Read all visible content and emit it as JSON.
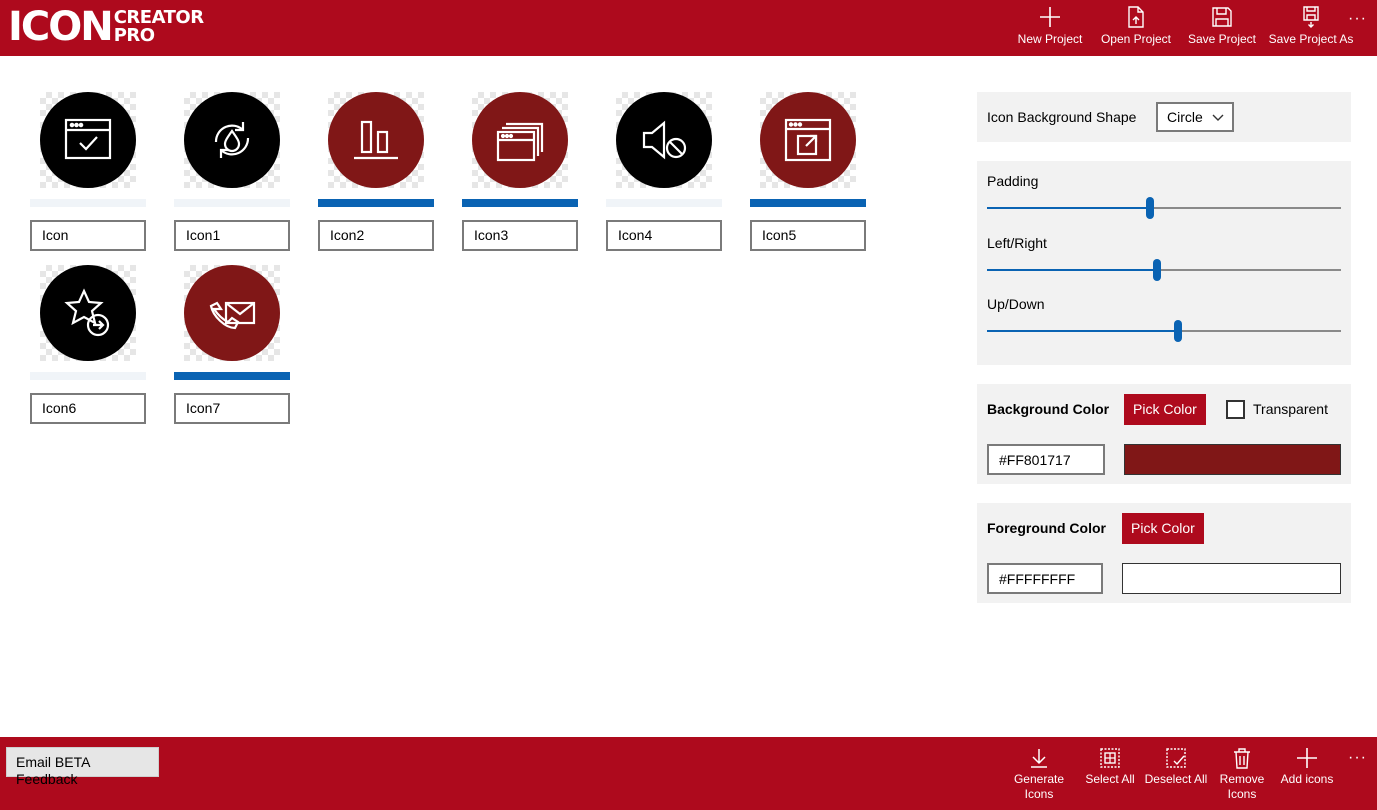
{
  "app": {
    "logo_main": "ICON",
    "logo_line1": "CREATOR",
    "logo_line2": "PRO"
  },
  "top_toolbar": {
    "new_project": "New Project",
    "open_project": "Open Project",
    "save_project": "Save Project",
    "save_project_as": "Save Project As"
  },
  "icons": [
    {
      "name": "Icon",
      "glyph": "browser-check-icon",
      "bg": "#000000",
      "selected": false
    },
    {
      "name": "Icon1",
      "glyph": "refresh-drop-icon",
      "bg": "#000000",
      "selected": false
    },
    {
      "name": "Icon2",
      "glyph": "align-bottom-icon",
      "bg": "#801717",
      "selected": true
    },
    {
      "name": "Icon3",
      "glyph": "windows-stack-icon",
      "bg": "#801717",
      "selected": true
    },
    {
      "name": "Icon4",
      "glyph": "volume-blocked-icon",
      "bg": "#000000",
      "selected": false
    },
    {
      "name": "Icon5",
      "glyph": "browser-open-link-icon",
      "bg": "#801717",
      "selected": true
    },
    {
      "name": "Icon6",
      "glyph": "star-arrow-icon",
      "bg": "#000000",
      "selected": false
    },
    {
      "name": "Icon7",
      "glyph": "phone-mail-icon",
      "bg": "#801717",
      "selected": true
    }
  ],
  "settings": {
    "shape_label": "Icon Background Shape",
    "shape_value": "Circle",
    "padding_label": "Padding",
    "padding_value": 0.46,
    "leftright_label": "Left/Right",
    "leftright_value": 0.48,
    "updown_label": "Up/Down",
    "updown_value": 0.54,
    "bg_color_label": "Background Color",
    "bg_pick_label": "Pick Color",
    "transparent_label": "Transparent",
    "transparent_checked": false,
    "bg_color_value": "#FF801717",
    "bg_swatch": "#801717",
    "fg_color_label": "Foreground Color",
    "fg_pick_label": "Pick Color",
    "fg_color_value": "#FFFFFFFF",
    "fg_swatch": "#FFFFFF"
  },
  "bottom_toolbar": {
    "feedback": "Email BETA Feedback",
    "generate": "Generate Icons",
    "select_all": "Select All",
    "deselect_all": "Deselect All",
    "remove_icons": "Remove Icons",
    "add_icons": "Add icons"
  },
  "colors": {
    "brand": "#AE0A1D",
    "accent": "#0A63B3"
  }
}
